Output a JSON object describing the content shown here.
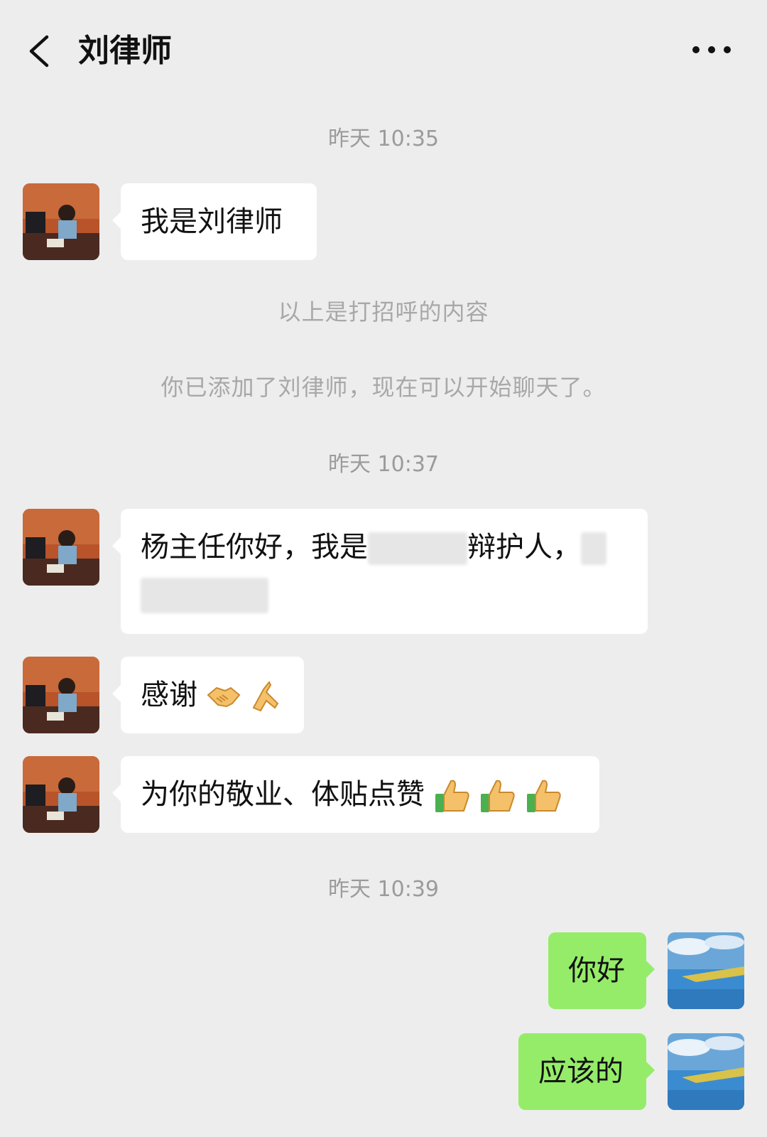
{
  "header": {
    "title": "刘律师",
    "back_icon": "chevron-left-icon",
    "more_icon": "more-dots-icon"
  },
  "messages": {
    "time1": "昨天 10:35",
    "m1": "我是刘律师",
    "sys1": "以上是打招呼的内容",
    "sys2": "你已添加了刘律师，现在可以开始聊天了。",
    "time2": "昨天 10:37",
    "m2_part1": "杨主任你好，我是",
    "m2_part2": "辩护人，",
    "m3": "感谢",
    "m4": "为你的敬业、体贴点赞",
    "time3": "昨天 10:39",
    "m5": "你好",
    "m6": "应该的"
  },
  "colors": {
    "background": "#ededed",
    "incoming_bubble": "#ffffff",
    "outgoing_bubble": "#95ec69"
  }
}
